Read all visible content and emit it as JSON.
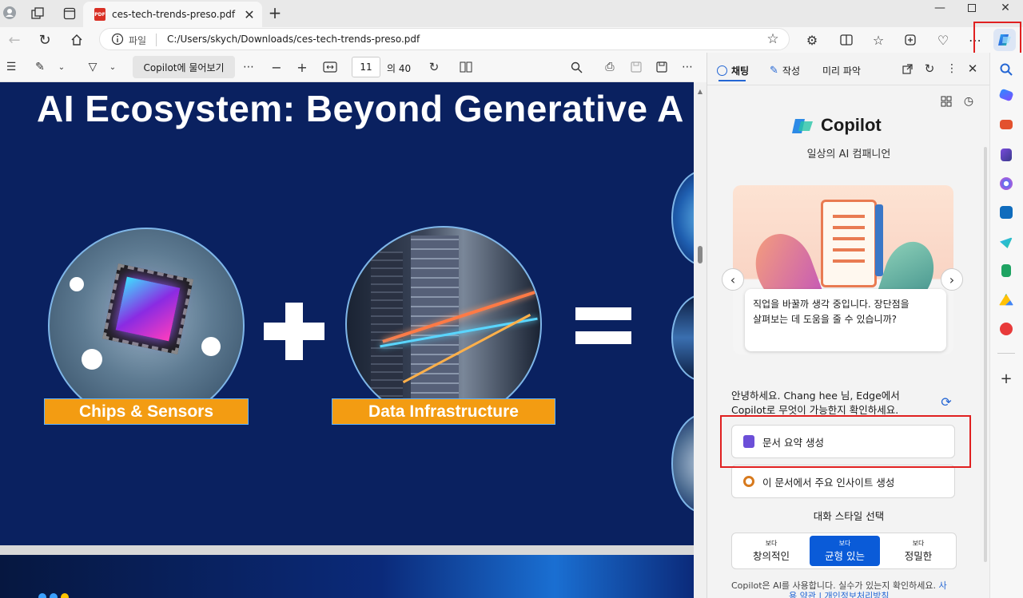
{
  "browser": {
    "tab_title": "ces-tech-trends-preso.pdf",
    "address_prefix": "파일",
    "address_url": "C:/Users/skych/Downloads/ces-tech-trends-preso.pdf"
  },
  "pdf_toolbar": {
    "copilot_button": "Copilot에 물어보기",
    "current_page": "11",
    "total_pages": "의 40"
  },
  "slide": {
    "title": "AI Ecosystem: Beyond Generative A",
    "label_left": "Chips & Sensors",
    "label_middle": "Data Infrastructure"
  },
  "copilot": {
    "tabs": [
      "채팅",
      "작성",
      "미리 파악"
    ],
    "brand": "Copilot",
    "tagline": "일상의 AI 컴패니언",
    "card_text_line1": "직업을 바꿀까 생각 중입니다. 장단점을",
    "card_text_line2": "살펴보는 데 도움을 줄 수 있습니까?",
    "greeting_line1": "안녕하세요. Chang hee 님, Edge에서",
    "greeting_line2": "Copilot로 무엇이 가능한지 확인하세요.",
    "suggestion1": "문서 요약 생성",
    "suggestion2": "이 문서에서 주요 인사이트 생성",
    "style_heading": "대화 스타일 선택",
    "styles": [
      {
        "small": "보다",
        "label": "창의적인"
      },
      {
        "small": "보다",
        "label": "균형 있는"
      },
      {
        "small": "보다",
        "label": "정밀한"
      }
    ],
    "footer_line1": "Copilot은 AI를 사용합니다. 실수가 있는지 확인하세요.",
    "footer_link": "사",
    "footer_line2": "용 약관 | 개인정보처리방침"
  },
  "colors": {
    "slide_bg": "#0a2160",
    "orange_label": "#f39c12",
    "selected_style": "#0a5bd8",
    "highlight_red": "#e02020"
  }
}
